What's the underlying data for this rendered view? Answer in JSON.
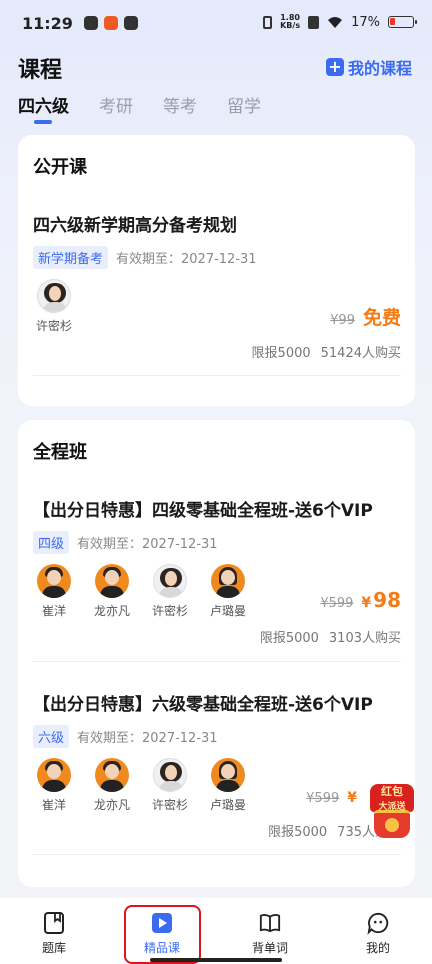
{
  "status_bar": {
    "time": "11:29",
    "speed_top": "1.80",
    "speed_bottom": "KB/s",
    "battery": "17%"
  },
  "header": {
    "title": "课程",
    "my_courses": "我的课程",
    "tabs": [
      "四六级",
      "考研",
      "等考",
      "留学"
    ]
  },
  "public_card": {
    "heading": "公开课",
    "course": {
      "title": "四六级新学期高分备考规划",
      "tag": "新学期备考",
      "validity": "有效期至：2027-12-31",
      "teachers": [
        "许密杉"
      ],
      "old_price": "¥99",
      "price": "免费",
      "limit": "限报5000",
      "buyers": "51424人购买"
    }
  },
  "full_card": {
    "heading": "全程班",
    "courses": [
      {
        "title": "【出分日特惠】四级零基础全程班-送6个VIP",
        "tag": "四级",
        "validity": "有效期至：2027-12-31",
        "teachers": [
          "崔洋",
          "龙亦凡",
          "许密杉",
          "卢璐曼"
        ],
        "old_price": "¥599",
        "currency": "¥",
        "price": "98",
        "limit": "限报5000",
        "buyers": "3103人购买"
      },
      {
        "title": "【出分日特惠】六级零基础全程班-送6个VIP",
        "tag": "六级",
        "validity": "有效期至：2027-12-31",
        "teachers": [
          "崔洋",
          "龙亦凡",
          "许密杉",
          "卢璐曼"
        ],
        "old_price": "¥599",
        "currency": "¥",
        "limit": "限报5000",
        "buyers": "735人购买"
      }
    ]
  },
  "red_packet": {
    "line1": "红包",
    "line2": "大派送"
  },
  "bottom_nav": [
    {
      "label": "题库",
      "icon": "book-icon"
    },
    {
      "label": "精品课",
      "icon": "play-icon"
    },
    {
      "label": "背单词",
      "icon": "open-book-icon"
    },
    {
      "label": "我的",
      "icon": "chat-icon"
    }
  ],
  "colors": {
    "accent": "#3b6cf0",
    "price": "#f57c14",
    "highlight": "#e0141b"
  }
}
